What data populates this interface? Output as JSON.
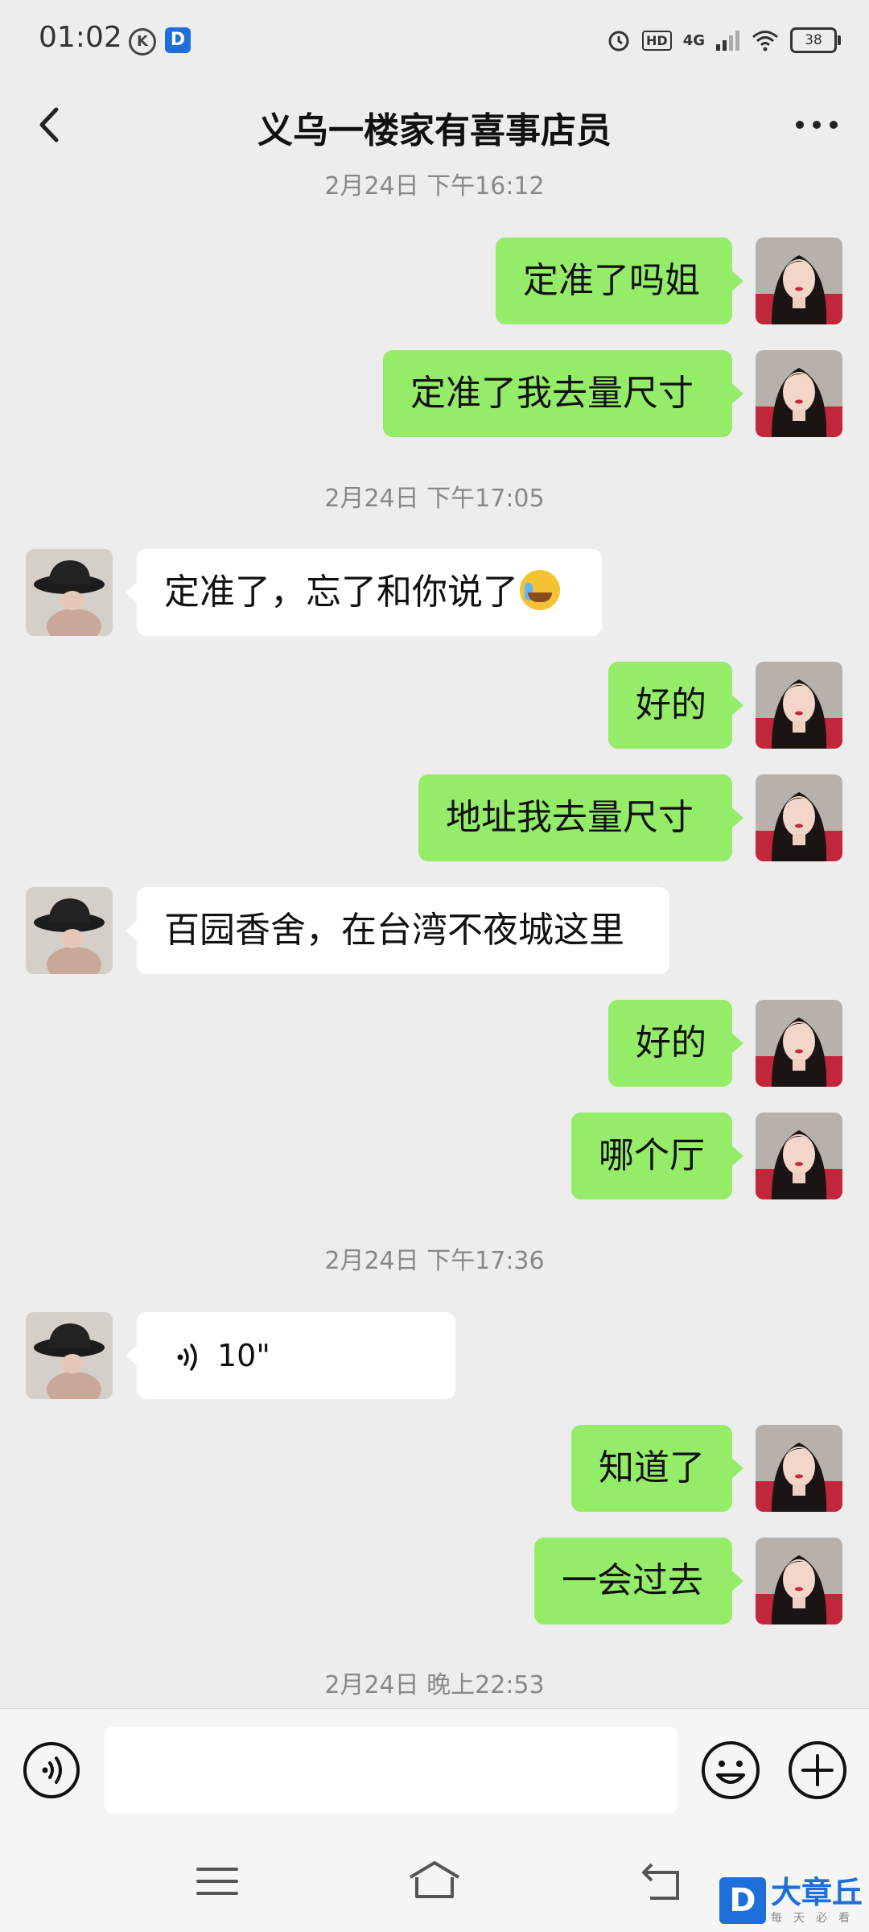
{
  "status_bar": {
    "time": "01:02",
    "k_badge": "K",
    "d_badge": "D",
    "hd": "HD",
    "network": "4G",
    "battery": "38"
  },
  "header": {
    "title": "义乌一楼家有喜事店员",
    "back_icon": "chevron-left-icon",
    "more_icon": "more-dots-icon"
  },
  "messages": {
    "ts1": "2月24日 下午16:12",
    "m1": "定准了吗姐",
    "m2": "定准了我去量尺寸",
    "ts2": "2月24日 下午17:05",
    "m3": "定准了，忘了和你说了",
    "m3_emoji": "crying-laughing-emoji",
    "m4": "好的",
    "m5": "地址我去量尺寸",
    "m6": "百园香舍，在台湾不夜城这里",
    "m7": "好的",
    "m8": "哪个厅",
    "ts3": "2月24日 下午17:36",
    "voice_duration": "10\"",
    "m9": "知道了",
    "m10": "一会过去",
    "ts4": "2月24日 晚上22:53"
  },
  "input_bar": {
    "placeholder": "",
    "voice_icon": "voice-mode-icon",
    "emoji_icon": "emoji-icon",
    "plus_icon": "plus-icon"
  },
  "watermark": {
    "logo": "D",
    "title": "大章丘",
    "subtitle": "每天必看"
  },
  "colors": {
    "background": "#ededed",
    "outgoing_bubble": "#95ec69",
    "incoming_bubble": "#ffffff",
    "timestamp_text": "#888888"
  }
}
